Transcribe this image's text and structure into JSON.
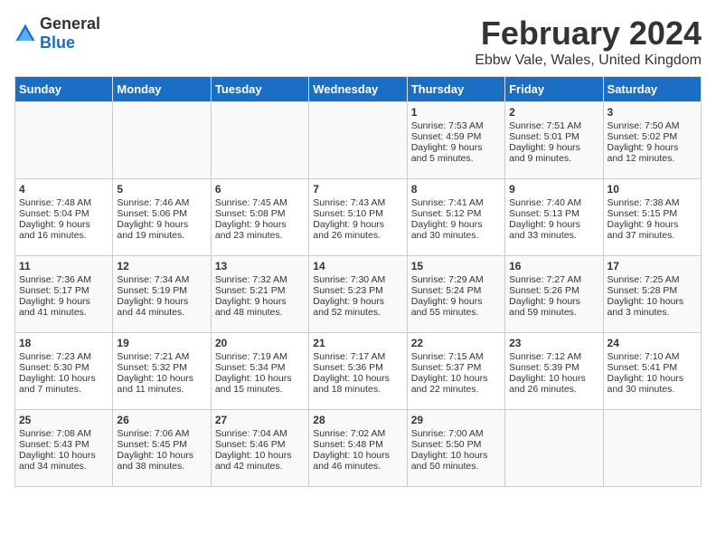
{
  "logo": {
    "text_general": "General",
    "text_blue": "Blue"
  },
  "title": "February 2024",
  "subtitle": "Ebbw Vale, Wales, United Kingdom",
  "days_of_week": [
    "Sunday",
    "Monday",
    "Tuesday",
    "Wednesday",
    "Thursday",
    "Friday",
    "Saturday"
  ],
  "weeks": [
    [
      {
        "day": "",
        "content": ""
      },
      {
        "day": "",
        "content": ""
      },
      {
        "day": "",
        "content": ""
      },
      {
        "day": "",
        "content": ""
      },
      {
        "day": "1",
        "content": "Sunrise: 7:53 AM\nSunset: 4:59 PM\nDaylight: 9 hours\nand 5 minutes."
      },
      {
        "day": "2",
        "content": "Sunrise: 7:51 AM\nSunset: 5:01 PM\nDaylight: 9 hours\nand 9 minutes."
      },
      {
        "day": "3",
        "content": "Sunrise: 7:50 AM\nSunset: 5:02 PM\nDaylight: 9 hours\nand 12 minutes."
      }
    ],
    [
      {
        "day": "4",
        "content": "Sunrise: 7:48 AM\nSunset: 5:04 PM\nDaylight: 9 hours\nand 16 minutes."
      },
      {
        "day": "5",
        "content": "Sunrise: 7:46 AM\nSunset: 5:06 PM\nDaylight: 9 hours\nand 19 minutes."
      },
      {
        "day": "6",
        "content": "Sunrise: 7:45 AM\nSunset: 5:08 PM\nDaylight: 9 hours\nand 23 minutes."
      },
      {
        "day": "7",
        "content": "Sunrise: 7:43 AM\nSunset: 5:10 PM\nDaylight: 9 hours\nand 26 minutes."
      },
      {
        "day": "8",
        "content": "Sunrise: 7:41 AM\nSunset: 5:12 PM\nDaylight: 9 hours\nand 30 minutes."
      },
      {
        "day": "9",
        "content": "Sunrise: 7:40 AM\nSunset: 5:13 PM\nDaylight: 9 hours\nand 33 minutes."
      },
      {
        "day": "10",
        "content": "Sunrise: 7:38 AM\nSunset: 5:15 PM\nDaylight: 9 hours\nand 37 minutes."
      }
    ],
    [
      {
        "day": "11",
        "content": "Sunrise: 7:36 AM\nSunset: 5:17 PM\nDaylight: 9 hours\nand 41 minutes."
      },
      {
        "day": "12",
        "content": "Sunrise: 7:34 AM\nSunset: 5:19 PM\nDaylight: 9 hours\nand 44 minutes."
      },
      {
        "day": "13",
        "content": "Sunrise: 7:32 AM\nSunset: 5:21 PM\nDaylight: 9 hours\nand 48 minutes."
      },
      {
        "day": "14",
        "content": "Sunrise: 7:30 AM\nSunset: 5:23 PM\nDaylight: 9 hours\nand 52 minutes."
      },
      {
        "day": "15",
        "content": "Sunrise: 7:29 AM\nSunset: 5:24 PM\nDaylight: 9 hours\nand 55 minutes."
      },
      {
        "day": "16",
        "content": "Sunrise: 7:27 AM\nSunset: 5:26 PM\nDaylight: 9 hours\nand 59 minutes."
      },
      {
        "day": "17",
        "content": "Sunrise: 7:25 AM\nSunset: 5:28 PM\nDaylight: 10 hours\nand 3 minutes."
      }
    ],
    [
      {
        "day": "18",
        "content": "Sunrise: 7:23 AM\nSunset: 5:30 PM\nDaylight: 10 hours\nand 7 minutes."
      },
      {
        "day": "19",
        "content": "Sunrise: 7:21 AM\nSunset: 5:32 PM\nDaylight: 10 hours\nand 11 minutes."
      },
      {
        "day": "20",
        "content": "Sunrise: 7:19 AM\nSunset: 5:34 PM\nDaylight: 10 hours\nand 15 minutes."
      },
      {
        "day": "21",
        "content": "Sunrise: 7:17 AM\nSunset: 5:36 PM\nDaylight: 10 hours\nand 18 minutes."
      },
      {
        "day": "22",
        "content": "Sunrise: 7:15 AM\nSunset: 5:37 PM\nDaylight: 10 hours\nand 22 minutes."
      },
      {
        "day": "23",
        "content": "Sunrise: 7:12 AM\nSunset: 5:39 PM\nDaylight: 10 hours\nand 26 minutes."
      },
      {
        "day": "24",
        "content": "Sunrise: 7:10 AM\nSunset: 5:41 PM\nDaylight: 10 hours\nand 30 minutes."
      }
    ],
    [
      {
        "day": "25",
        "content": "Sunrise: 7:08 AM\nSunset: 5:43 PM\nDaylight: 10 hours\nand 34 minutes."
      },
      {
        "day": "26",
        "content": "Sunrise: 7:06 AM\nSunset: 5:45 PM\nDaylight: 10 hours\nand 38 minutes."
      },
      {
        "day": "27",
        "content": "Sunrise: 7:04 AM\nSunset: 5:46 PM\nDaylight: 10 hours\nand 42 minutes."
      },
      {
        "day": "28",
        "content": "Sunrise: 7:02 AM\nSunset: 5:48 PM\nDaylight: 10 hours\nand 46 minutes."
      },
      {
        "day": "29",
        "content": "Sunrise: 7:00 AM\nSunset: 5:50 PM\nDaylight: 10 hours\nand 50 minutes."
      },
      {
        "day": "",
        "content": ""
      },
      {
        "day": "",
        "content": ""
      }
    ]
  ]
}
